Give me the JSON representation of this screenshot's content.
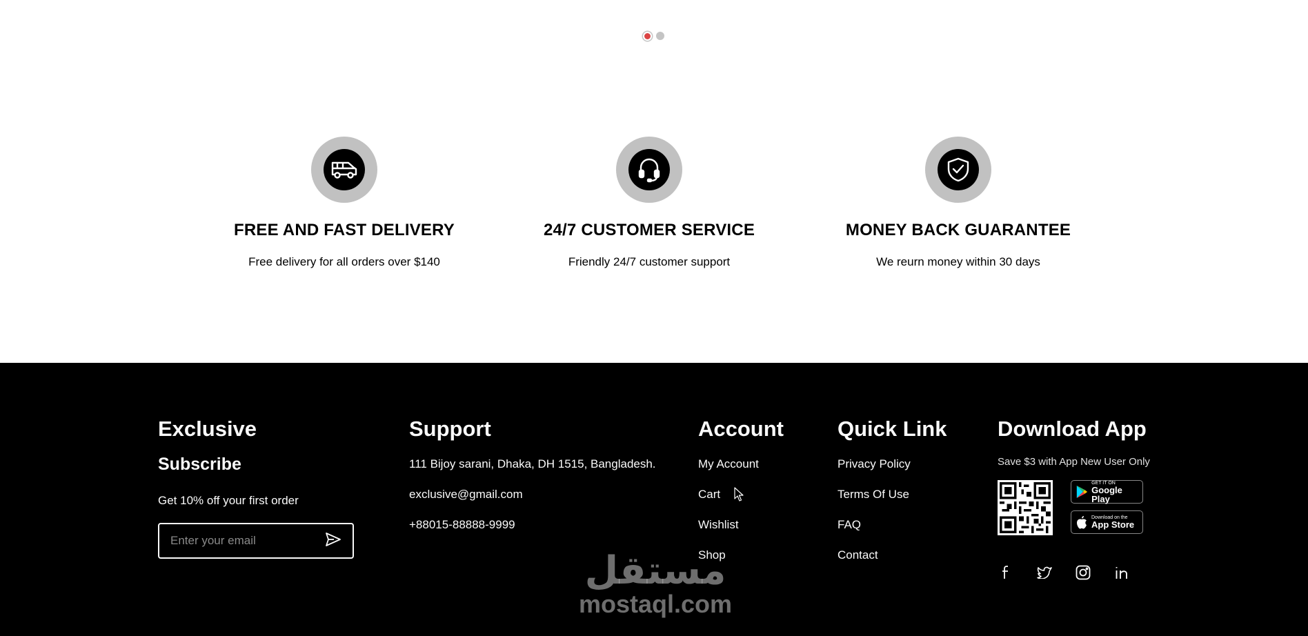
{
  "carousel": {
    "dots": 2,
    "active_index": 0
  },
  "services": [
    {
      "icon": "delivery-van-icon",
      "title": "FREE AND FAST DELIVERY",
      "description": "Free delivery for all orders over $140"
    },
    {
      "icon": "headset-icon",
      "title": "24/7 CUSTOMER SERVICE",
      "description": "Friendly 24/7 customer support"
    },
    {
      "icon": "shield-check-icon",
      "title": "MONEY BACK GUARANTEE",
      "description": "We reurn money within 30 days"
    }
  ],
  "footer": {
    "exclusive": {
      "heading": "Exclusive",
      "subheading": "Subscribe",
      "offer": "Get 10% off your first order",
      "email_placeholder": "Enter your email"
    },
    "support": {
      "heading": "Support",
      "address": "111 Bijoy sarani, Dhaka,  DH 1515, Bangladesh.",
      "email": "exclusive@gmail.com",
      "phone": "+88015-88888-9999"
    },
    "account": {
      "heading": "Account",
      "links": [
        "My Account",
        "Cart",
        "Wishlist",
        "Shop"
      ]
    },
    "quick_link": {
      "heading": "Quick Link",
      "links": [
        "Privacy Policy",
        "Terms Of Use",
        "FAQ",
        "Contact"
      ]
    },
    "download_app": {
      "heading": "Download App",
      "note": "Save $3 with App New User Only",
      "google_play": {
        "small": "GET IT ON",
        "big": "Google Play"
      },
      "app_store": {
        "small": "Download on the",
        "big": "App Store"
      },
      "socials": [
        "facebook-icon",
        "twitter-icon",
        "instagram-icon",
        "linkedin-icon"
      ]
    }
  },
  "watermark": {
    "arabic": "مستقل",
    "latin": "mostaql.com"
  },
  "colors": {
    "accent": "#db4444",
    "footer_bg": "#000000",
    "icon_ring": "#c1c1c1"
  }
}
